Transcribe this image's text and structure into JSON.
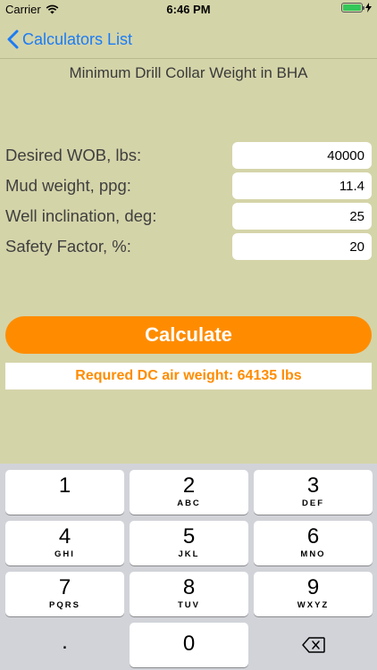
{
  "status": {
    "carrier": "Carrier",
    "time": "6:46 PM"
  },
  "nav": {
    "back_label": "Calculators List"
  },
  "page": {
    "title": "Minimum Drill Collar Weight in BHA"
  },
  "form": {
    "fields": [
      {
        "label": "Desired WOB, lbs:",
        "value": "40000"
      },
      {
        "label": "Mud weight, ppg:",
        "value": "11.4"
      },
      {
        "label": "Well inclination, deg:",
        "value": "25"
      },
      {
        "label": "Safety Factor, %:",
        "value": "20"
      }
    ]
  },
  "calculate": {
    "label": "Calculate"
  },
  "result": {
    "text": "Requred DC air weight: 64135 lbs"
  },
  "keyboard": {
    "keys": [
      {
        "num": "1",
        "letters": ""
      },
      {
        "num": "2",
        "letters": "ABC"
      },
      {
        "num": "3",
        "letters": "DEF"
      },
      {
        "num": "4",
        "letters": "GHI"
      },
      {
        "num": "5",
        "letters": "JKL"
      },
      {
        "num": "6",
        "letters": "MNO"
      },
      {
        "num": "7",
        "letters": "PQRS"
      },
      {
        "num": "8",
        "letters": "TUV"
      },
      {
        "num": "9",
        "letters": "WXYZ"
      },
      {
        "num": "0",
        "letters": ""
      }
    ],
    "dot": "."
  },
  "colors": {
    "accent": "#ff8c00",
    "link": "#1b7cf5",
    "background": "#d4d4a9",
    "battery": "#34c759"
  }
}
